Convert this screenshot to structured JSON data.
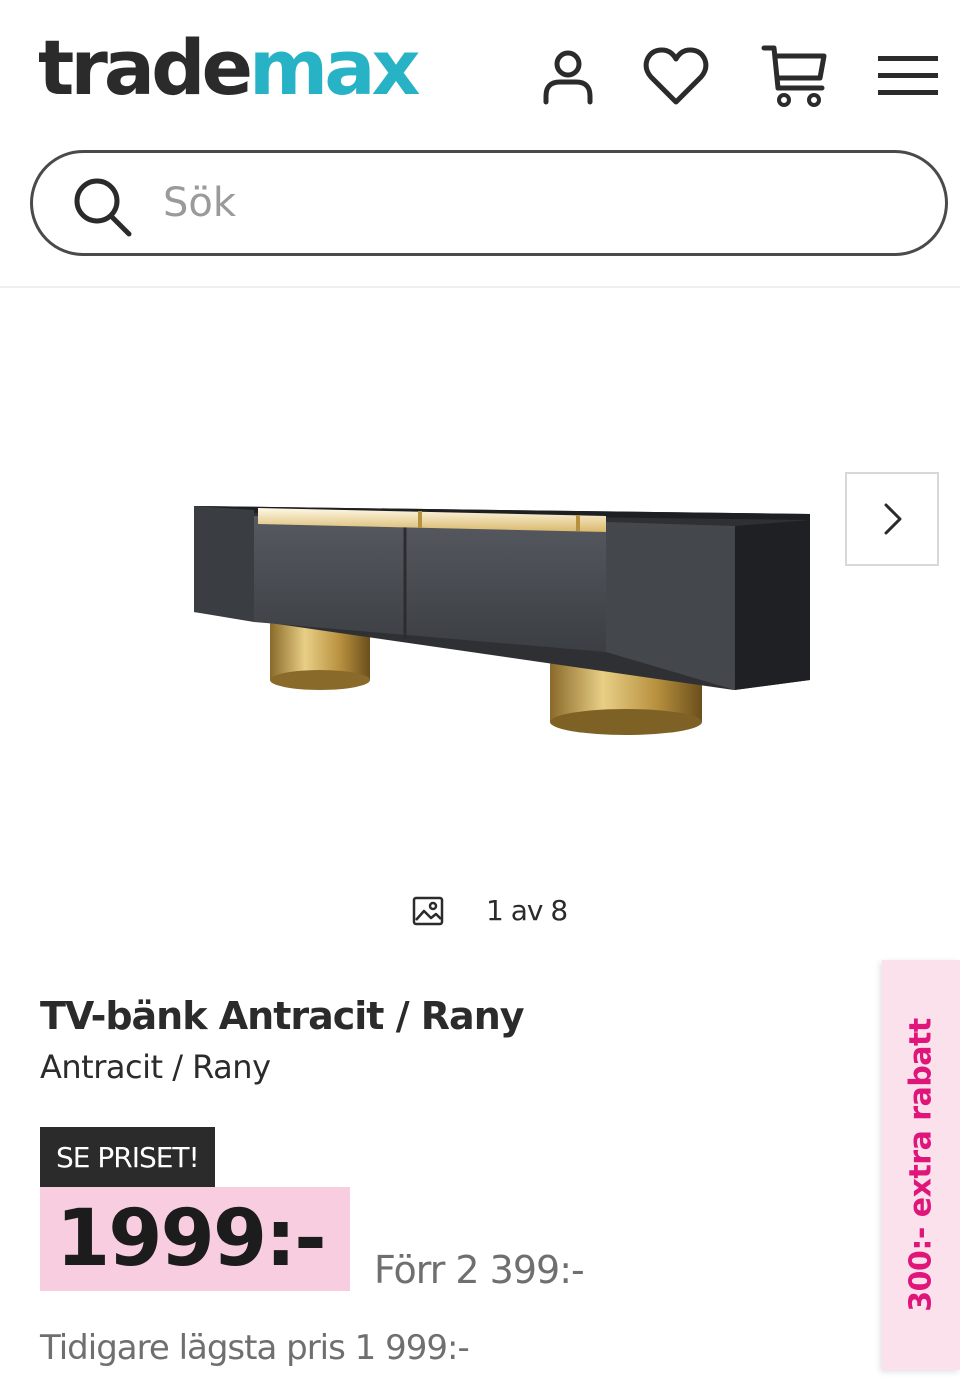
{
  "header": {
    "logo_part1": "trade",
    "logo_part2": "max",
    "icons": [
      "account-icon",
      "heart-icon",
      "cart-icon",
      "menu-icon"
    ]
  },
  "search": {
    "placeholder": "Sök"
  },
  "gallery": {
    "counter_text": "1 av 8",
    "current": 1,
    "total": 8
  },
  "product": {
    "title": "TV-bänk Antracit / Rany",
    "subtitle": "Antracit / Rany",
    "badge": "SE PRISET!",
    "price": "1999:-",
    "old_price": "Förr 2 399:-",
    "lowest_price": "Tidigare lägsta pris 1 999:-"
  },
  "promo": {
    "side_tab": "300:- extra rabatt"
  },
  "colors": {
    "brand_dark": "#2b2b2b",
    "brand_teal": "#27b3c5",
    "price_bg": "#f9cde0",
    "promo_pink": "#e0157a"
  }
}
